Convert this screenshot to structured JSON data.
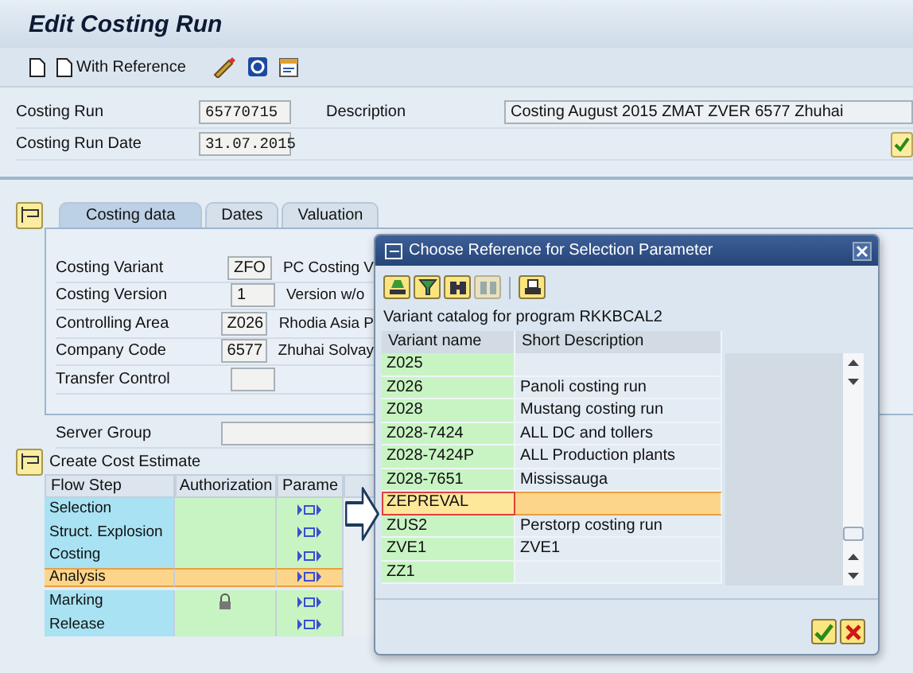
{
  "window": {
    "title": "Edit Costing Run"
  },
  "toolbar": {
    "with_reference": "With Reference"
  },
  "header": {
    "fields": [
      {
        "label": "Costing Run",
        "value": "65770715"
      },
      {
        "label": "Costing Run Date",
        "value": "31.07.2015"
      }
    ],
    "description_label": "Description",
    "description_value": "Costing August 2015 ZMAT ZVER 6577 Zhuhai"
  },
  "tabs": [
    {
      "label": "Costing data",
      "selected": true
    },
    {
      "label": "Dates",
      "selected": false
    },
    {
      "label": "Valuation",
      "selected": false
    }
  ],
  "costing_data": {
    "fields": [
      {
        "label": "Costing Variant",
        "value": "ZFO",
        "text": "PC Costing V"
      },
      {
        "label": "Costing Version",
        "value": "1",
        "text": "Version w/o"
      },
      {
        "label": "Controlling Area",
        "value": "Z026",
        "text": "Rhodia Asia P"
      },
      {
        "label": "Company Code",
        "value": "6577",
        "text": "Zhuhai Solvay"
      },
      {
        "label": "Transfer Control"
      }
    ],
    "server_group": "Server Group"
  },
  "cost_estimate": {
    "title": "Create Cost Estimate",
    "columns": [
      "Flow Step",
      "Authorization",
      "Parame"
    ],
    "steps": [
      {
        "name": "Selection",
        "locked": false,
        "selected": false
      },
      {
        "name": "Struct. Explosion",
        "locked": false,
        "selected": false
      },
      {
        "name": "Costing",
        "locked": false,
        "selected": false
      },
      {
        "name": "Analysis",
        "locked": false,
        "selected": true
      },
      {
        "name": "Marking",
        "locked": true,
        "selected": false
      },
      {
        "name": "Release",
        "locked": false,
        "selected": false
      }
    ]
  },
  "dialog": {
    "title": "Choose Reference for Selection Parameter",
    "caption": "Variant catalog for program RKKBCAL2",
    "columns": [
      "Variant name",
      "Short Description"
    ],
    "rows": [
      {
        "name": "Z025",
        "selected": false
      },
      {
        "name": "Z026",
        "description": "Panoli costing run",
        "selected": false
      },
      {
        "name": "Z028",
        "description": "Mustang costing run",
        "selected": false
      },
      {
        "name": "Z028-7424",
        "description": "ALL DC and tollers",
        "selected": false
      },
      {
        "name": "Z028-7424P",
        "description": "ALL Production plants",
        "selected": false
      },
      {
        "name": "Z028-7651",
        "description": "Mississauga",
        "selected": false
      },
      {
        "name": "ZEPREVAL",
        "selected": true
      },
      {
        "name": "ZUS2",
        "description": "Perstorp costing run",
        "selected": false
      },
      {
        "name": "ZVE1",
        "description": "ZVE1",
        "selected": false
      },
      {
        "name": "ZZ1",
        "selected": false
      }
    ]
  }
}
